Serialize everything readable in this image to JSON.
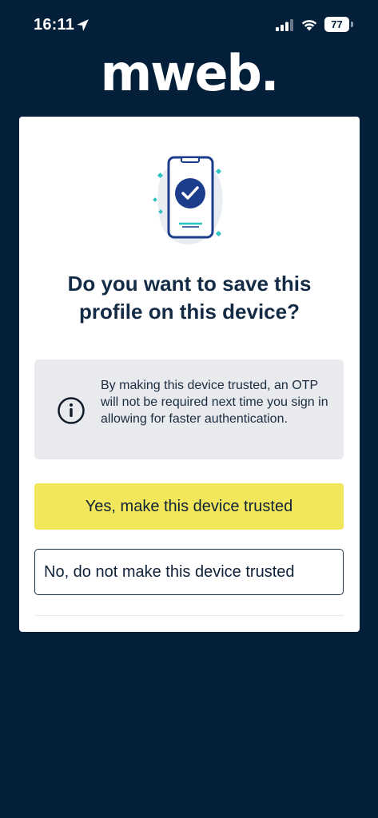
{
  "status_bar": {
    "time": "16:11",
    "battery_level": "77",
    "icons": [
      "location-arrow-icon",
      "cellular-signal-icon",
      "wifi-icon",
      "battery-icon"
    ]
  },
  "brand": {
    "logo_text": "mweb."
  },
  "dialog": {
    "illustration": "phone-checkmark-icon",
    "title": "Do you want to save this profile on this device?",
    "info": {
      "icon": "info-icon",
      "text": "By making this device trusted, an OTP will not be required next time you sign in allowing for faster authentication."
    },
    "primary_button": "Yes, make this device trusted",
    "secondary_button": "No, do not make this device trusted"
  },
  "colors": {
    "background": "#041f3a",
    "primary_button": "#f2e65a",
    "phone_accent": "#1c3d8c",
    "teal_accent": "#2ec4c0",
    "info_box": "#e8eaee"
  }
}
